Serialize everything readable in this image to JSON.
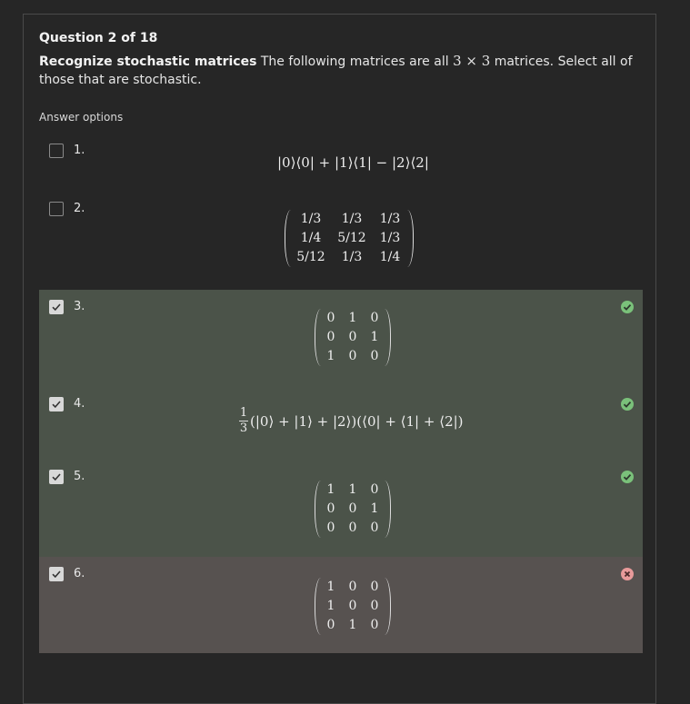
{
  "header": {
    "question_number": "Question 2 of 18"
  },
  "question": {
    "title": "Recognize stochastic matrices",
    "text_before": "The following matrices are all ",
    "math_inline": "3 × 3",
    "text_after": " matrices. Select all of those that are stochastic."
  },
  "answer_options_label": "Answer options",
  "options": [
    {
      "number": "1.",
      "checked": false,
      "status": "none",
      "expr": "|0⟩⟨0| + |1⟩⟨1| − |2⟩⟨2|"
    },
    {
      "number": "2.",
      "checked": false,
      "status": "none",
      "matrix": [
        [
          "1/3",
          "1/3",
          "1/3"
        ],
        [
          "1/4",
          "5/12",
          "1/3"
        ],
        [
          "5/12",
          "1/3",
          "1/4"
        ]
      ]
    },
    {
      "number": "3.",
      "checked": true,
      "status": "correct",
      "matrix": [
        [
          "0",
          "1",
          "0"
        ],
        [
          "0",
          "0",
          "1"
        ],
        [
          "1",
          "0",
          "0"
        ]
      ]
    },
    {
      "number": "4.",
      "checked": true,
      "status": "correct",
      "frac_num": "1",
      "frac_den": "3",
      "expr": "(|0⟩ + |1⟩ + |2⟩)(⟨0| + ⟨1| + ⟨2|)"
    },
    {
      "number": "5.",
      "checked": true,
      "status": "correct",
      "matrix": [
        [
          "1",
          "1",
          "0"
        ],
        [
          "0",
          "0",
          "1"
        ],
        [
          "0",
          "0",
          "0"
        ]
      ]
    },
    {
      "number": "6.",
      "checked": true,
      "status": "incorrect",
      "matrix": [
        [
          "1",
          "0",
          "0"
        ],
        [
          "1",
          "0",
          "0"
        ],
        [
          "0",
          "1",
          "0"
        ]
      ]
    }
  ],
  "colors": {
    "correct_bg": "#4b5349",
    "incorrect_bg": "#575250",
    "correct_icon": "#7ac17a",
    "incorrect_icon": "#e89a9a"
  }
}
